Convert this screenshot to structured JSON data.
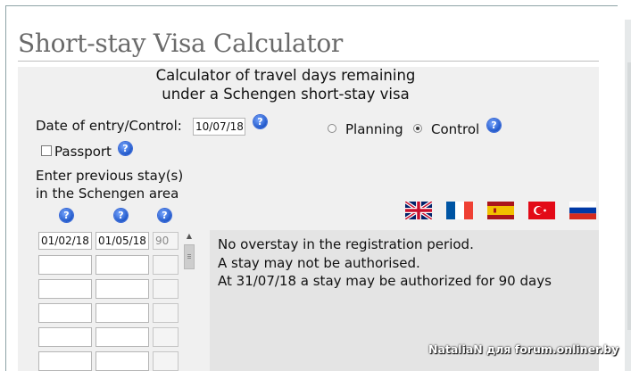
{
  "page": {
    "title": "Short-stay Visa Calculator",
    "subtitle_line1": "Calculator of travel days remaining",
    "subtitle_line2": "under a Schengen short-stay visa"
  },
  "form": {
    "entry_label": "Date of entry/Control:",
    "entry_value": "10/07/18",
    "mode_options": [
      {
        "label": "Planning",
        "selected": false
      },
      {
        "label": "Control",
        "selected": true
      }
    ],
    "passport_label": "Passport",
    "passport_checked": false,
    "stays_label_line1": "Enter previous stay(s)",
    "stays_label_line2": "in the Schengen area"
  },
  "stays": {
    "rows": [
      {
        "entry": "01/02/18",
        "exit": "01/05/18",
        "days": "90"
      },
      {
        "entry": "",
        "exit": "",
        "days": ""
      },
      {
        "entry": "",
        "exit": "",
        "days": ""
      },
      {
        "entry": "",
        "exit": "",
        "days": ""
      },
      {
        "entry": "",
        "exit": "",
        "days": ""
      },
      {
        "entry": "",
        "exit": "",
        "days": ""
      }
    ]
  },
  "result": {
    "line1": "No overstay in the registration period.",
    "line2": "A stay may not be authorised.",
    "line3": "At 31/07/18 a stay may be authorized for 90 days"
  },
  "languages": [
    "flag-uk-icon",
    "flag-france-icon",
    "flag-spain-icon",
    "flag-turkey-icon",
    "flag-russia-icon"
  ],
  "watermark": "NataliaN для forum.onliner.by",
  "colors": {
    "help_icon": "#1f57c9",
    "panel_bg": "#f0f0f0",
    "result_bg": "#e4e4e4",
    "title": "#6a6a6a"
  }
}
